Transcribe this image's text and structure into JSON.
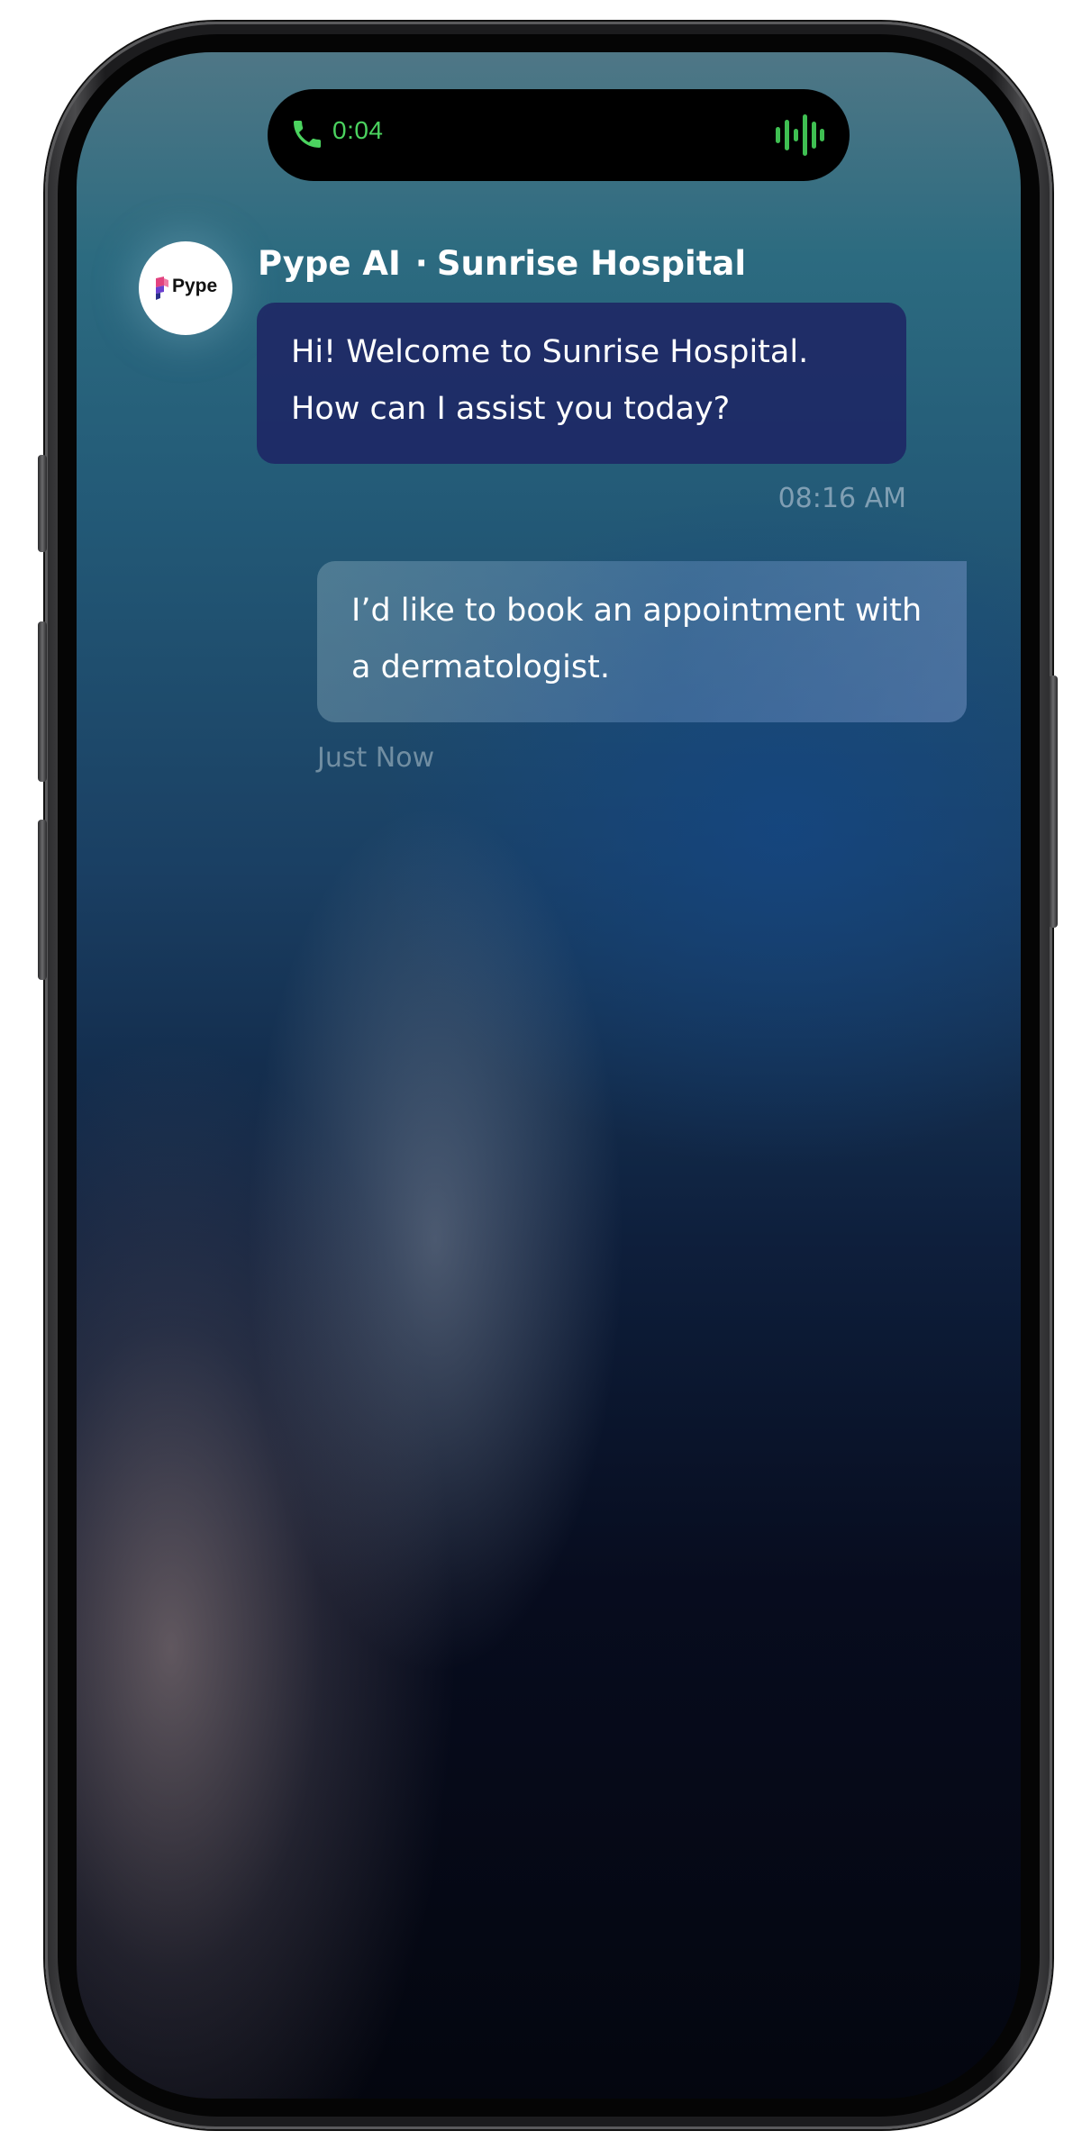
{
  "call": {
    "duration": "0:04",
    "status_color": "#4bd35f"
  },
  "agent": {
    "name": "Pype AI",
    "separator": "·",
    "organization": "Sunrise Hospital",
    "avatar_logo_text": "Pype"
  },
  "messages": [
    {
      "sender": "agent",
      "lines": [
        "Hi! Welcome to Sunrise Hospital.",
        "How can I assist you today?"
      ],
      "timestamp": "08:16 AM"
    },
    {
      "sender": "user",
      "lines": [
        "I’d like to book an appointment with",
        "a dermatologist."
      ],
      "timestamp": "Just Now"
    }
  ],
  "icons": {
    "call": "phone-icon",
    "audio": "waveform-icon",
    "logo": "pype-logo-icon"
  },
  "colors": {
    "agent_bubble": "#1e2664",
    "call_green": "#4bd35f"
  }
}
